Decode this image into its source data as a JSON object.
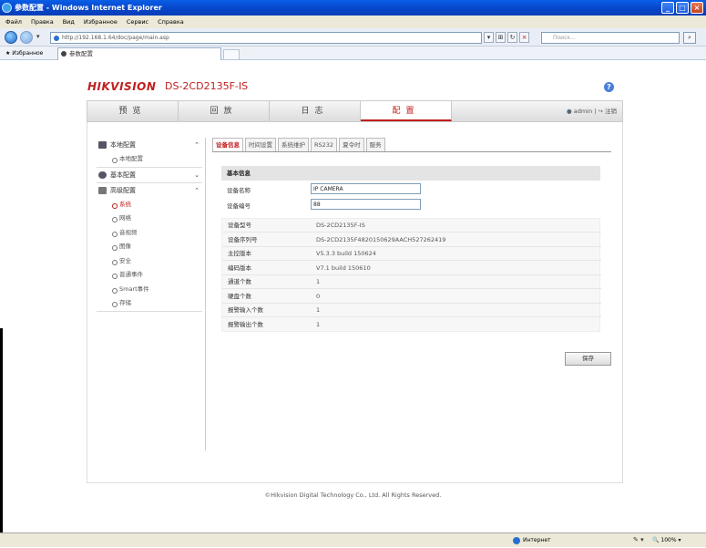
{
  "window": {
    "title": "参数配置 - Windows Internet Explorer"
  },
  "menubar": [
    "Файл",
    "Правка",
    "Вид",
    "Избранное",
    "Сервис",
    "Справка"
  ],
  "address": {
    "url": "http://192.168.1.64/doc/page/main.asp",
    "search_placeholder": "Поиск..."
  },
  "favbar": {
    "favorites_label": "Избранное",
    "tab_title": "参数配置"
  },
  "header": {
    "brand": "HIKVISION",
    "model": "DS-2CD2135F-IS"
  },
  "mainnav": {
    "items": [
      "预览",
      "回放",
      "日志",
      "配置"
    ],
    "active": 3,
    "user": "admin",
    "separator": "|",
    "logout": "注销"
  },
  "sidebar": {
    "groups": [
      {
        "label": "本地配置",
        "items": [
          "本地配置"
        ]
      },
      {
        "label": "基本配置",
        "items": []
      },
      {
        "label": "高级配置",
        "items": [
          "系统",
          "网络",
          "音视频",
          "图像",
          "安全",
          "普通事件",
          "Smart事件",
          "存储"
        ]
      }
    ]
  },
  "subtabs": [
    "设备信息",
    "时间设置",
    "系统维护",
    "RS232",
    "夏令时",
    "服务"
  ],
  "section_title": "基本信息",
  "fields": [
    {
      "label": "设备名称",
      "value": "IP CAMERA"
    },
    {
      "label": "设备编号",
      "value": "88"
    }
  ],
  "info": [
    {
      "label": "设备型号",
      "value": "DS-2CD2135F-IS"
    },
    {
      "label": "设备序列号",
      "value": "DS-2CD2135F4820150629AACH527262419"
    },
    {
      "label": "主控版本",
      "value": "V5.3.3 build 150624"
    },
    {
      "label": "编码版本",
      "value": "V7.1 build 150610"
    },
    {
      "label": "通道个数",
      "value": "1"
    },
    {
      "label": "硬盘个数",
      "value": "0"
    },
    {
      "label": "报警输入个数",
      "value": "1"
    },
    {
      "label": "报警输出个数",
      "value": "1"
    }
  ],
  "save_label": "保存",
  "copyright": "©Hikvision Digital Technology Co., Ltd. All Rights Reserved.",
  "statusbar": {
    "zone": "Интернет",
    "zoom": "100%"
  }
}
